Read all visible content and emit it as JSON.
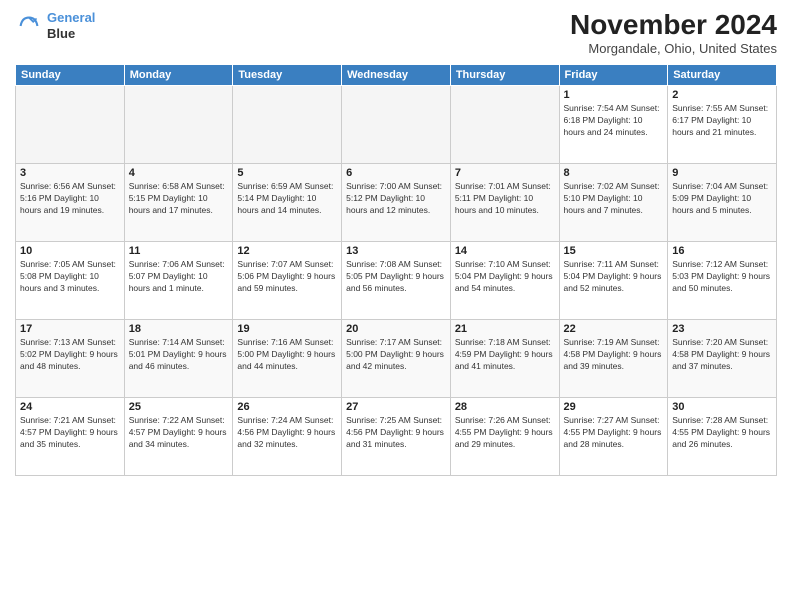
{
  "header": {
    "logo_line1": "General",
    "logo_line2": "Blue",
    "month_title": "November 2024",
    "location": "Morgandale, Ohio, United States"
  },
  "days_of_week": [
    "Sunday",
    "Monday",
    "Tuesday",
    "Wednesday",
    "Thursday",
    "Friday",
    "Saturday"
  ],
  "weeks": [
    [
      {
        "day": "",
        "info": ""
      },
      {
        "day": "",
        "info": ""
      },
      {
        "day": "",
        "info": ""
      },
      {
        "day": "",
        "info": ""
      },
      {
        "day": "",
        "info": ""
      },
      {
        "day": "1",
        "info": "Sunrise: 7:54 AM\nSunset: 6:18 PM\nDaylight: 10 hours and 24 minutes."
      },
      {
        "day": "2",
        "info": "Sunrise: 7:55 AM\nSunset: 6:17 PM\nDaylight: 10 hours and 21 minutes."
      }
    ],
    [
      {
        "day": "3",
        "info": "Sunrise: 6:56 AM\nSunset: 5:16 PM\nDaylight: 10 hours and 19 minutes."
      },
      {
        "day": "4",
        "info": "Sunrise: 6:58 AM\nSunset: 5:15 PM\nDaylight: 10 hours and 17 minutes."
      },
      {
        "day": "5",
        "info": "Sunrise: 6:59 AM\nSunset: 5:14 PM\nDaylight: 10 hours and 14 minutes."
      },
      {
        "day": "6",
        "info": "Sunrise: 7:00 AM\nSunset: 5:12 PM\nDaylight: 10 hours and 12 minutes."
      },
      {
        "day": "7",
        "info": "Sunrise: 7:01 AM\nSunset: 5:11 PM\nDaylight: 10 hours and 10 minutes."
      },
      {
        "day": "8",
        "info": "Sunrise: 7:02 AM\nSunset: 5:10 PM\nDaylight: 10 hours and 7 minutes."
      },
      {
        "day": "9",
        "info": "Sunrise: 7:04 AM\nSunset: 5:09 PM\nDaylight: 10 hours and 5 minutes."
      }
    ],
    [
      {
        "day": "10",
        "info": "Sunrise: 7:05 AM\nSunset: 5:08 PM\nDaylight: 10 hours and 3 minutes."
      },
      {
        "day": "11",
        "info": "Sunrise: 7:06 AM\nSunset: 5:07 PM\nDaylight: 10 hours and 1 minute."
      },
      {
        "day": "12",
        "info": "Sunrise: 7:07 AM\nSunset: 5:06 PM\nDaylight: 9 hours and 59 minutes."
      },
      {
        "day": "13",
        "info": "Sunrise: 7:08 AM\nSunset: 5:05 PM\nDaylight: 9 hours and 56 minutes."
      },
      {
        "day": "14",
        "info": "Sunrise: 7:10 AM\nSunset: 5:04 PM\nDaylight: 9 hours and 54 minutes."
      },
      {
        "day": "15",
        "info": "Sunrise: 7:11 AM\nSunset: 5:04 PM\nDaylight: 9 hours and 52 minutes."
      },
      {
        "day": "16",
        "info": "Sunrise: 7:12 AM\nSunset: 5:03 PM\nDaylight: 9 hours and 50 minutes."
      }
    ],
    [
      {
        "day": "17",
        "info": "Sunrise: 7:13 AM\nSunset: 5:02 PM\nDaylight: 9 hours and 48 minutes."
      },
      {
        "day": "18",
        "info": "Sunrise: 7:14 AM\nSunset: 5:01 PM\nDaylight: 9 hours and 46 minutes."
      },
      {
        "day": "19",
        "info": "Sunrise: 7:16 AM\nSunset: 5:00 PM\nDaylight: 9 hours and 44 minutes."
      },
      {
        "day": "20",
        "info": "Sunrise: 7:17 AM\nSunset: 5:00 PM\nDaylight: 9 hours and 42 minutes."
      },
      {
        "day": "21",
        "info": "Sunrise: 7:18 AM\nSunset: 4:59 PM\nDaylight: 9 hours and 41 minutes."
      },
      {
        "day": "22",
        "info": "Sunrise: 7:19 AM\nSunset: 4:58 PM\nDaylight: 9 hours and 39 minutes."
      },
      {
        "day": "23",
        "info": "Sunrise: 7:20 AM\nSunset: 4:58 PM\nDaylight: 9 hours and 37 minutes."
      }
    ],
    [
      {
        "day": "24",
        "info": "Sunrise: 7:21 AM\nSunset: 4:57 PM\nDaylight: 9 hours and 35 minutes."
      },
      {
        "day": "25",
        "info": "Sunrise: 7:22 AM\nSunset: 4:57 PM\nDaylight: 9 hours and 34 minutes."
      },
      {
        "day": "26",
        "info": "Sunrise: 7:24 AM\nSunset: 4:56 PM\nDaylight: 9 hours and 32 minutes."
      },
      {
        "day": "27",
        "info": "Sunrise: 7:25 AM\nSunset: 4:56 PM\nDaylight: 9 hours and 31 minutes."
      },
      {
        "day": "28",
        "info": "Sunrise: 7:26 AM\nSunset: 4:55 PM\nDaylight: 9 hours and 29 minutes."
      },
      {
        "day": "29",
        "info": "Sunrise: 7:27 AM\nSunset: 4:55 PM\nDaylight: 9 hours and 28 minutes."
      },
      {
        "day": "30",
        "info": "Sunrise: 7:28 AM\nSunset: 4:55 PM\nDaylight: 9 hours and 26 minutes."
      }
    ]
  ]
}
